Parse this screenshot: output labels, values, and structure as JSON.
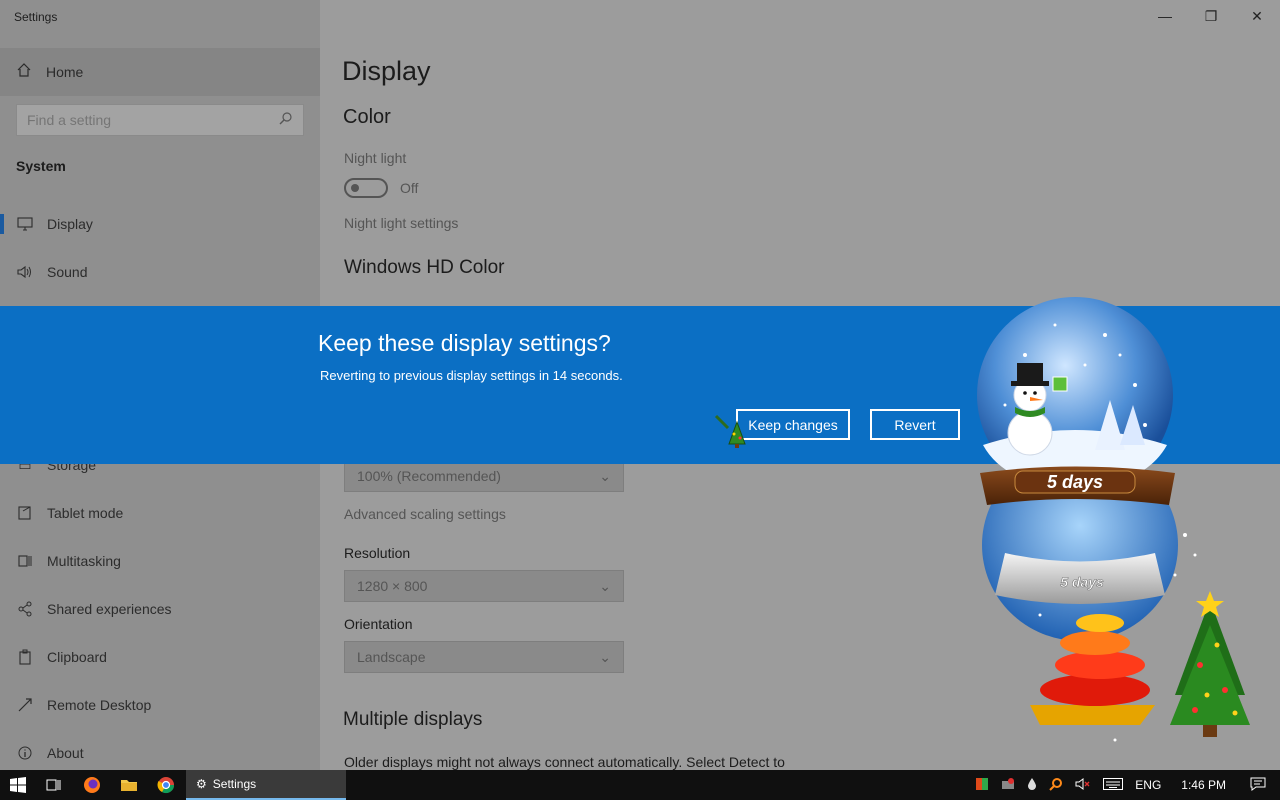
{
  "window": {
    "title": "Settings",
    "controls": {
      "minimize": "—",
      "restore": "❐",
      "close": "✕"
    }
  },
  "sidebar": {
    "home_label": "Home",
    "search_placeholder": "Find a setting",
    "section": "System",
    "items": [
      {
        "label": "Display",
        "icon": "monitor-icon",
        "active": true
      },
      {
        "label": "Sound",
        "icon": "speaker-icon"
      },
      {
        "label": "Storage",
        "icon": "storage-icon"
      },
      {
        "label": "Tablet mode",
        "icon": "tablet-icon"
      },
      {
        "label": "Multitasking",
        "icon": "multitasking-icon"
      },
      {
        "label": "Shared experiences",
        "icon": "share-icon"
      },
      {
        "label": "Clipboard",
        "icon": "clipboard-icon"
      },
      {
        "label": "Remote Desktop",
        "icon": "remote-icon"
      },
      {
        "label": "About",
        "icon": "info-icon"
      }
    ]
  },
  "main": {
    "title": "Display",
    "color_heading": "Color",
    "night_light_label": "Night light",
    "night_light_state": "Off",
    "night_light_settings": "Night light settings",
    "hd_color_heading": "Windows HD Color",
    "scale_value": "100% (Recommended)",
    "advanced_scaling": "Advanced scaling settings",
    "resolution_label": "Resolution",
    "resolution_value": "1280 × 800",
    "orientation_label": "Orientation",
    "orientation_value": "Landscape",
    "multiple_displays_heading": "Multiple displays",
    "multiple_displays_text": "Older displays might not always connect automatically. Select Detect to"
  },
  "dialog": {
    "title": "Keep these display settings?",
    "subtitle": "Reverting to previous display settings in 14 seconds.",
    "keep_label": "Keep changes",
    "revert_label": "Revert"
  },
  "widget": {
    "banner_text": "5 days",
    "base_text": "5 days"
  },
  "taskbar": {
    "app_label": "Settings",
    "language": "ENG",
    "time": "1:46 PM"
  },
  "colors": {
    "accent_blue": "#0b6fc4",
    "taskbar": "#101010"
  }
}
